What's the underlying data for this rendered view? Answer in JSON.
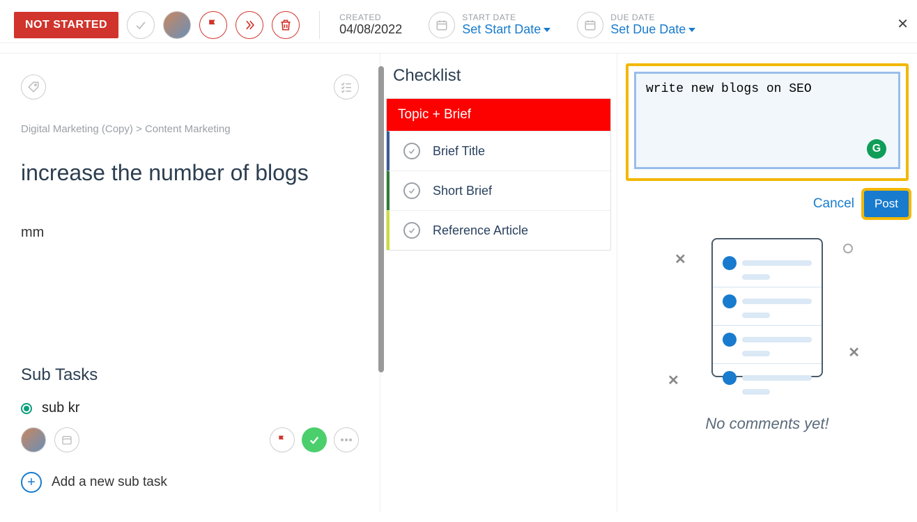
{
  "toolbar": {
    "status": "NOT STARTED",
    "created_label": "CREATED",
    "created_date": "04/08/2022",
    "start_label": "START DATE",
    "start_link": "Set Start Date",
    "due_label": "DUE DATE",
    "due_link": "Set Due Date"
  },
  "breadcrumb": "Digital Marketing (Copy) > Content Marketing",
  "task": {
    "title": "increase the number of blogs",
    "description": "mm"
  },
  "subtasks": {
    "heading": "Sub Tasks",
    "items": [
      {
        "name": "sub kr"
      }
    ],
    "add_label": "Add a new sub task"
  },
  "checklist": {
    "heading": "Checklist",
    "section": "Topic + Brief",
    "items": [
      "Brief Title",
      "Short Brief",
      "Reference Article"
    ]
  },
  "comments": {
    "input": "write new blogs on SEO",
    "cancel": "Cancel",
    "post": "Post",
    "empty": "No comments yet!"
  }
}
